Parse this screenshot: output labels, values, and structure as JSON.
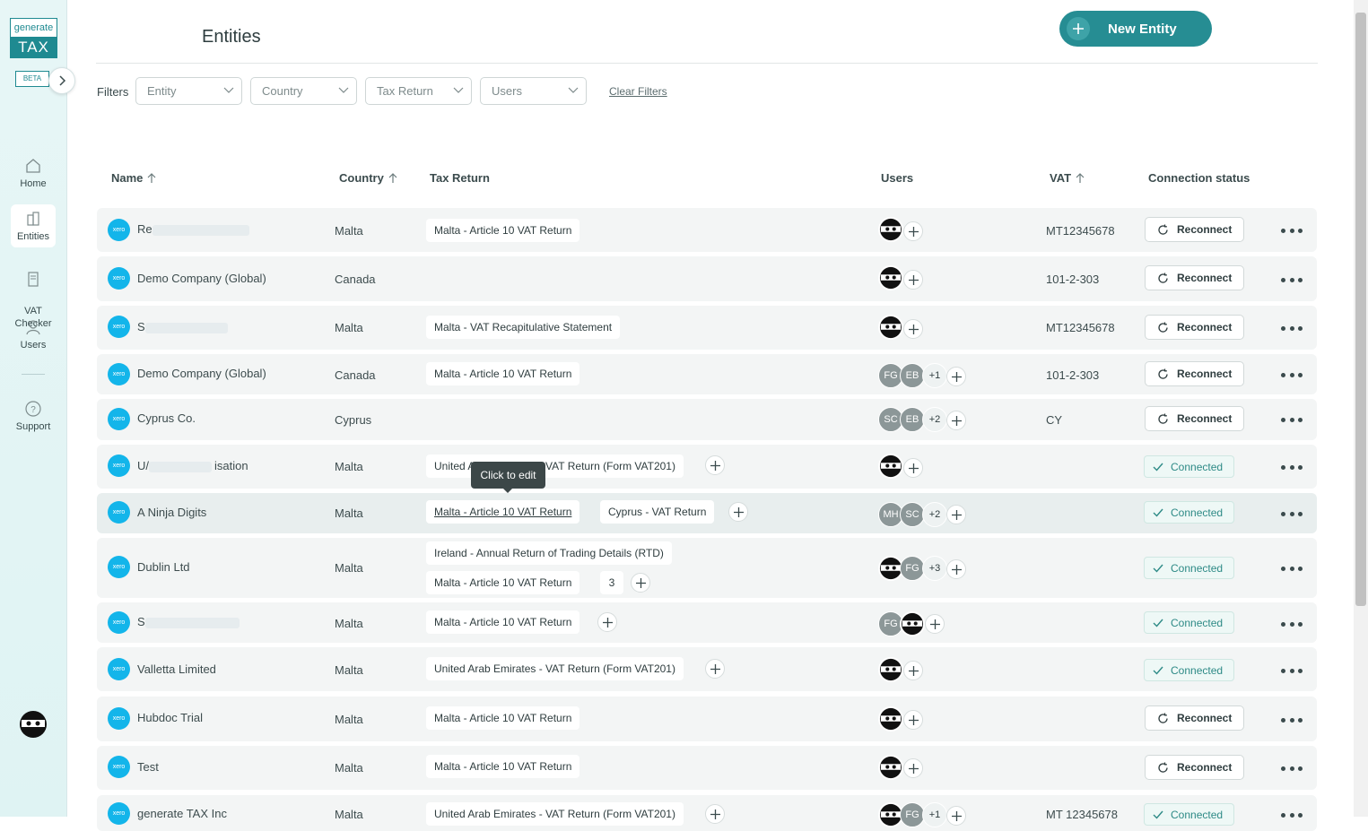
{
  "brand": {
    "logo_top": "generate",
    "logo_bottom": "TAX",
    "beta": "BETA"
  },
  "sidebar": {
    "items": [
      {
        "label": "Home",
        "icon": "home-icon"
      },
      {
        "label": "Entities",
        "icon": "buildings-icon"
      },
      {
        "label": "VAT\nChecker",
        "icon": "receipt-icon"
      },
      {
        "label": "Users",
        "icon": "user-icon"
      },
      {
        "label": "Support",
        "icon": "help-icon"
      }
    ]
  },
  "header": {
    "title": "Entities",
    "new_button": "New Entity"
  },
  "filters": {
    "label": "Filters",
    "entity": "Entity",
    "country": "Country",
    "tax_return": "Tax Return",
    "users": "Users",
    "clear": "Clear Filters"
  },
  "table": {
    "columns": {
      "name": "Name",
      "country": "Country",
      "tax_return": "Tax Return",
      "users": "Users",
      "vat": "VAT",
      "status": "Connection status"
    },
    "rows": [
      {
        "name": "Re",
        "country": "Malta",
        "returns": [
          "Malta - Article 10 VAT Return"
        ],
        "vat": "MT12345678",
        "status": "Reconnect"
      },
      {
        "name": "Demo Company (Global)",
        "country": "Canada",
        "returns": [],
        "vat": "101-2-303",
        "status": "Reconnect"
      },
      {
        "name": "S",
        "country": "Malta",
        "returns": [
          "Malta - VAT Recapitulative Statement"
        ],
        "vat": "MT12345678",
        "status": "Reconnect"
      },
      {
        "name": "Demo Company (Global)",
        "country": "Canada",
        "returns": [
          "Malta - Article 10 VAT Return"
        ],
        "users": [
          "FG",
          "EB",
          "+1"
        ],
        "vat": "101-2-303",
        "status": "Reconnect"
      },
      {
        "name": "Cyprus Co.",
        "country": "Cyprus",
        "returns": [],
        "users": [
          "SC",
          "EB",
          "+2"
        ],
        "vat": "CY",
        "status": "Reconnect"
      },
      {
        "name_start": "U/",
        "name_end": "isation",
        "country": "Malta",
        "returns": [
          "United Arab Emirates - VAT Return (Form VAT201)"
        ],
        "vat": "",
        "status": "Connected"
      },
      {
        "name": "A Ninja Digits",
        "country": "Malta",
        "returns": [
          "Malta - Article 10 VAT Return",
          "Cyprus - VAT Return"
        ],
        "users": [
          "MH",
          "SC",
          "+2"
        ],
        "vat": "",
        "status": "Connected"
      },
      {
        "name": "Dublin Ltd",
        "country": "Malta",
        "returns": [
          "Ireland - Annual Return of Trading Details (RTD)",
          "Malta - Article 10 VAT Return"
        ],
        "extra_count": "3",
        "users": [
          "FG",
          "+3"
        ],
        "vat": "",
        "status": "Connected"
      },
      {
        "name": "S",
        "country": "Malta",
        "returns": [
          "Malta - Article 10 VAT Return"
        ],
        "users": [
          "FG"
        ],
        "vat": "",
        "status": "Connected"
      },
      {
        "name": "Valletta Limited",
        "country": "Malta",
        "returns": [
          "United Arab Emirates - VAT Return (Form VAT201)"
        ],
        "vat": "",
        "status": "Connected"
      },
      {
        "name": "Hubdoc Trial",
        "country": "Malta",
        "returns": [
          "Malta - Article 10 VAT Return"
        ],
        "vat": "",
        "status": "Reconnect"
      },
      {
        "name": "Test",
        "country": "Malta",
        "returns": [
          "Malta - Article 10 VAT Return"
        ],
        "vat": "",
        "status": "Reconnect"
      },
      {
        "name": "generate TAX Inc",
        "country": "Malta",
        "returns": [
          "United Arab Emirates - VAT Return (Form VAT201)"
        ],
        "users": [
          "FG",
          "+1"
        ],
        "vat": "MT 12345678",
        "status": "Connected"
      }
    ],
    "xero_label": "xero"
  },
  "tooltip": "Click to edit",
  "colors": {
    "accent": "#268d93",
    "xero": "#13b5ea",
    "connected": "#2d8a86"
  }
}
